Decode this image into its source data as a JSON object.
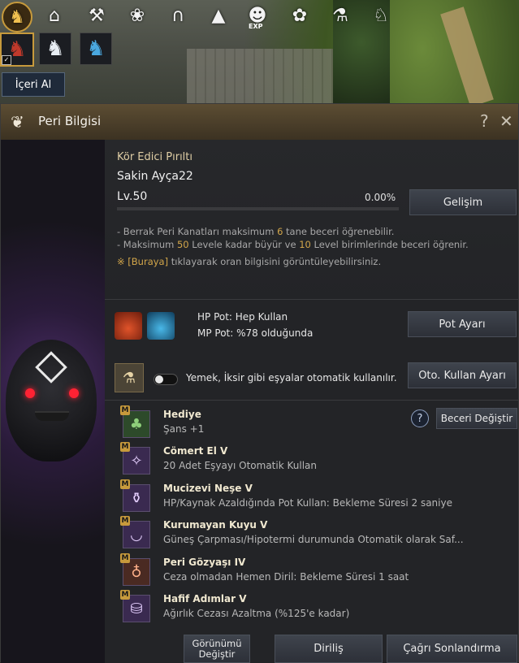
{
  "hud": {
    "icons": [
      "horse-icon",
      "home-icon",
      "pickaxe-icon",
      "paw-icon",
      "saddle-icon",
      "camp-icon",
      "guild-icon",
      "butterfly-icon",
      "alchemy-icon",
      "horse-head-icon"
    ],
    "exp_label": "EXP",
    "horses": [
      "red-horse",
      "white-horse",
      "blue-horse"
    ],
    "stable_button": "İçeri Al"
  },
  "window": {
    "title": "Peri Bilgisi",
    "help_glyph": "?",
    "close_glyph": "✕"
  },
  "pet": {
    "name": "Kör Edici Pırıltı",
    "owner": "Sakin Ayça22",
    "level_label": "Lv.",
    "level_value": "50",
    "exp_percent": "0.00%",
    "exp_fraction": 0.0,
    "evolve_button": "Gelişim"
  },
  "notes": {
    "line1_a": "- Berrak Peri Kanatları maksimum ",
    "line1_num": "6",
    "line1_b": " tane beceri öğrenebilir.",
    "line2_a": "- Maksimum ",
    "line2_num1": "50",
    "line2_b": " Levele kadar büyür ve ",
    "line2_num2": "10",
    "line2_c": " Level birimlerinde beceri öğrenir.",
    "line3_mark": "※ ",
    "line3_link": "[Buraya]",
    "line3_rest": " tıklayarak oran bilgisini görüntüleyebilirsiniz."
  },
  "pots": {
    "hp": "HP Pot: Hep Kullan",
    "mp": "MP Pot: %78 olduğunda",
    "settings_button": "Pot Ayarı"
  },
  "auto_use": {
    "label": "Yemek, İksir gibi eşyalar otomatik kullanılır.",
    "enabled": false,
    "settings_button": "Oto. Kullan Ayarı"
  },
  "skills": {
    "change_button": "Beceri Değiştir",
    "help_glyph": "?",
    "list": [
      {
        "name": "Hediye",
        "desc": "Şans +1",
        "badge": "M",
        "icon": "clover-icon"
      },
      {
        "name": "Cömert El V",
        "desc": "20 Adet Eşyayı Otomatik Kullan",
        "badge": "M",
        "icon": "fairy-icon"
      },
      {
        "name": "Mucizevi Neşe V",
        "desc": "HP/Kaynak Azaldığında Pot Kullan: Bekleme Süresi 2 saniye",
        "badge": "M",
        "icon": "potion-flask-icon"
      },
      {
        "name": "Kurumayan Kuyu V",
        "desc": "Güneş Çarpması/Hipotermi durumunda Otomatik olarak Saf...",
        "badge": "M",
        "icon": "bowl-icon"
      },
      {
        "name": "Peri Gözyaşı IV",
        "desc": "Ceza olmadan Hemen Diril: Bekleme Süresi 1 saat",
        "badge": "M",
        "icon": "tear-vial-icon"
      },
      {
        "name": "Hafif Adımlar V",
        "desc": "Ağırlık Cezası Azaltma (%125'e kadar)",
        "badge": "M",
        "icon": "bag-icon"
      }
    ]
  },
  "footer": {
    "appearance_button": "Görünümü Değiştir",
    "revive_button": "Diriliş",
    "end_summon_button": "Çağrı Sonlandırma"
  }
}
